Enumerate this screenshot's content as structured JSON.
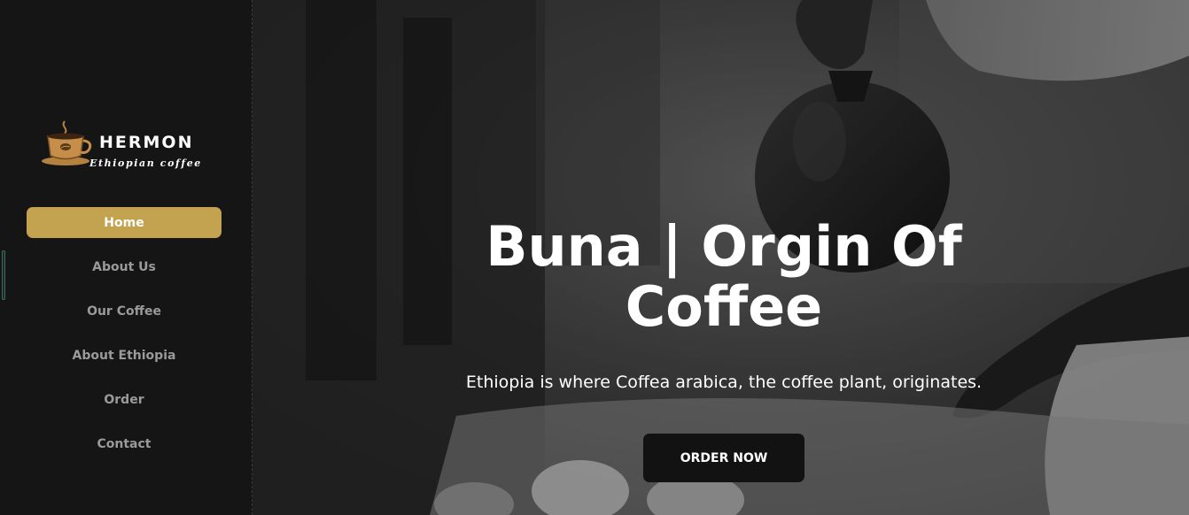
{
  "brand": {
    "name": "HERMON",
    "tagline": "Ethiopian coffee"
  },
  "nav": {
    "items": [
      {
        "label": "Home",
        "active": true
      },
      {
        "label": "About Us"
      },
      {
        "label": "Our Coffee"
      },
      {
        "label": "About Ethiopia"
      },
      {
        "label": "Order"
      },
      {
        "label": "Contact"
      }
    ]
  },
  "hero": {
    "title": "Buna | Orgin Of Coffee",
    "subtitle": "Ethiopia is where Coffea arabica, the coffee plant, originates.",
    "cta_label": "ORDER NOW",
    "background_image": "black-and-white photo of a jebena coffee pot pouring into cups"
  },
  "colors": {
    "sidebar_bg": "#151515",
    "accent_gold": "#c4a350",
    "nav_text": "#9a9a9a",
    "button_bg": "#121212",
    "text_white": "#ffffff"
  }
}
